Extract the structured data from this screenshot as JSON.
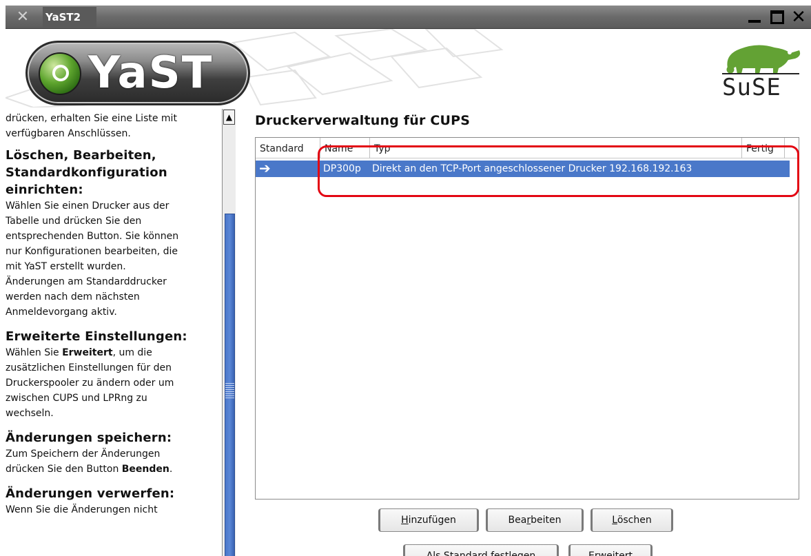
{
  "window": {
    "title": "YaST2",
    "icon": "x-window-icon",
    "controls": {
      "minimize": "minimize",
      "maximize": "maximize",
      "close": "close"
    }
  },
  "banner": {
    "yast_logo_text": "YaST",
    "suse_logo_text": "SuSE"
  },
  "help": {
    "scroll_up_icon": "arrow-up-icon",
    "intro_line1": "drücken, erhalten Sie eine Liste mit",
    "intro_line2": "verfügbaren Anschlüssen.",
    "sections": [
      {
        "heading_line1": "Löschen, Bearbeiten,",
        "heading_line2": "Standardkonfiguration",
        "heading_line3": "einrichten:",
        "lines": [
          "Wählen Sie einen Drucker aus der",
          "Tabelle und drücken Sie den",
          "entsprechenden Button. Sie können",
          "nur Konfigurationen bearbeiten, die",
          "mit YaST erstellt wurden.",
          "Änderungen am Standarddrucker",
          "werden nach dem nächsten",
          "Anmeldevorgang aktiv."
        ]
      },
      {
        "heading": "Erweiterte Einstellungen:",
        "line1_pre": "Wählen Sie ",
        "line1_bold": "Erweitert",
        "line1_post": ", um die",
        "lines": [
          "zusätzlichen Einstellungen für den",
          "Druckerspooler zu ändern oder um",
          "zwischen CUPS und LPRng zu",
          "wechseln."
        ]
      },
      {
        "heading": "Änderungen speichern:",
        "line1": "Zum Speichern der Änderungen",
        "line2_pre": "drücken Sie den Button ",
        "line2_bold": "Beenden",
        "line2_post": "."
      },
      {
        "heading": "Änderungen verwerfen:",
        "line1": "Wenn Sie die Änderungen nicht"
      }
    ]
  },
  "main": {
    "title": "Druckerverwaltung für CUPS",
    "columns": [
      "Standard",
      "Name",
      "Typ",
      "Fertig"
    ],
    "rows": [
      {
        "standard_icon": "arrow-right-icon",
        "standard": "➔",
        "name": "DP300p",
        "typ": "Direkt an den TCP-Port angeschlossener Drucker 192.168.192.163",
        "fertig": ""
      }
    ],
    "highlight_color": "#e30613",
    "selection_color": "#4a78c9"
  },
  "buttons": {
    "add": {
      "pre": "",
      "mnemonic": "H",
      "post": "inzufügen"
    },
    "edit": {
      "pre": "Bea",
      "mnemonic": "r",
      "post": "beiten"
    },
    "delete": {
      "pre": "",
      "mnemonic": "L",
      "post": "öschen"
    },
    "set_default": "Als Standard festlegen",
    "advanced": "Erweitert"
  }
}
